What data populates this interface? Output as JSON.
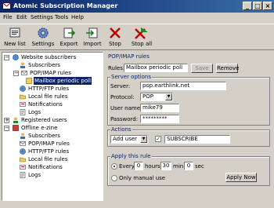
{
  "window": {
    "title": "Atomic Subscription Manager"
  },
  "menu": [
    "File",
    "Edit",
    "Settings",
    "Tools",
    "Help"
  ],
  "toolbar": [
    {
      "id": "new-list",
      "label": "New list",
      "icon": "new-list-icon"
    },
    {
      "id": "settings",
      "label": "Settings",
      "icon": "gear-icon"
    },
    {
      "id": "export",
      "label": "Export",
      "icon": "export-icon"
    },
    {
      "id": "import",
      "label": "Import",
      "icon": "import-icon"
    },
    {
      "id": "stop",
      "label": "Stop",
      "icon": "stop-icon"
    },
    {
      "id": "stop-all",
      "label": "Stop all",
      "icon": "stop-all-icon"
    }
  ],
  "tree": {
    "website_subscribers": "Website subscribers",
    "subscribers": "Subscribers",
    "pop_imap_rules": "POP/IMAP rules",
    "mailbox_periodic_poll": "Mailbox periodic poll",
    "http_ftp_rules": "HTTP/FTP rules",
    "local_file_rules": "Local file rules",
    "notifications": "Notifications",
    "logs": "Logs",
    "registered_users": "Registered users",
    "offline_ezine": "Offline e-zine",
    "subscribers2": "Subscribers",
    "pop_imap_rules2": "POP/IMAP rules",
    "http_ftp_rules2": "HTTP/FTP rules",
    "local_file_rules2": "Local file rules",
    "notifications2": "Notifications",
    "logs2": "Logs"
  },
  "panel": {
    "heading": "POP/IMAP rules",
    "rules_label": "Rules:",
    "rules_value": "Mailbox periodic poll",
    "save_label": "Save",
    "remove_label": "Remove",
    "server_options": {
      "caption": "Server options",
      "server_label": "Server:",
      "server_value": "pop.earthlink.net",
      "protocol_label": "Protocol:",
      "protocol_value": "POP",
      "username_label": "User name:",
      "username_value": "mike79",
      "password_label": "Password:",
      "password_value": "*********"
    },
    "actions": {
      "caption": "Actions",
      "action_value": "Add user",
      "keyword_value": "SUBSCRIBE",
      "keyword_checked": true
    },
    "apply": {
      "caption": "Apply this rule",
      "every_label": "Every:",
      "hours_value": "0",
      "hours_label": "hours",
      "min_value": "30",
      "min_label": "min",
      "sec_value": "0",
      "sec_label": "sec",
      "manual_label": "Only manual use",
      "apply_now_label": "Apply Now",
      "mode": "every"
    }
  }
}
